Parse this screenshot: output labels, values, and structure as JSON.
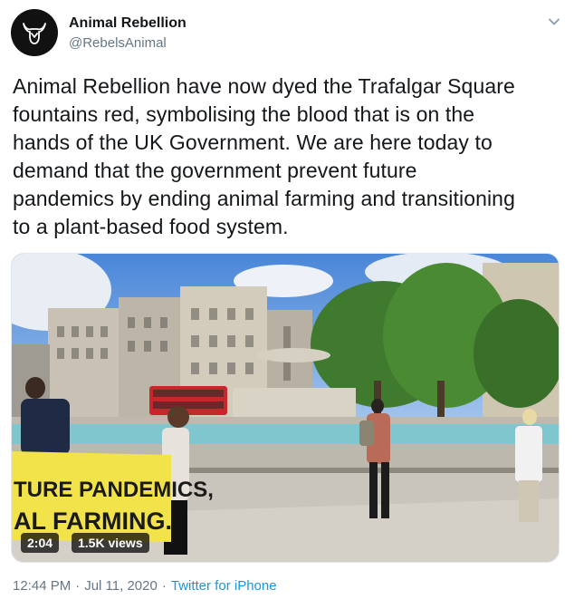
{
  "author": {
    "display_name": "Animal Rebellion",
    "handle": "@RebelsAnimal",
    "avatar_icon": "bull-logo-icon"
  },
  "tweet": {
    "text_lines": [
      "Animal Rebellion have now dyed the Trafalgar Square",
      "fountains red, symbolising the blood that is on the",
      "hands of the UK Government. We are here today to",
      "demand that the government prevent future",
      "pandemics by ending animal farming and transitioning",
      "to a plant-based food system."
    ]
  },
  "media": {
    "type": "video",
    "duration": "2:04",
    "views": "1.5K views",
    "banner_text_lines": [
      "TURE PANDEMICS,",
      "AL FARMING."
    ]
  },
  "footer": {
    "time": "12:44 PM",
    "date": "Jul 11, 2020",
    "separator": "·",
    "source": "Twitter for iPhone"
  },
  "colors": {
    "link": "#1b95e0",
    "secondary_text": "#657786",
    "primary_text": "#14171a",
    "banner_yellow": "#f3e34a"
  }
}
